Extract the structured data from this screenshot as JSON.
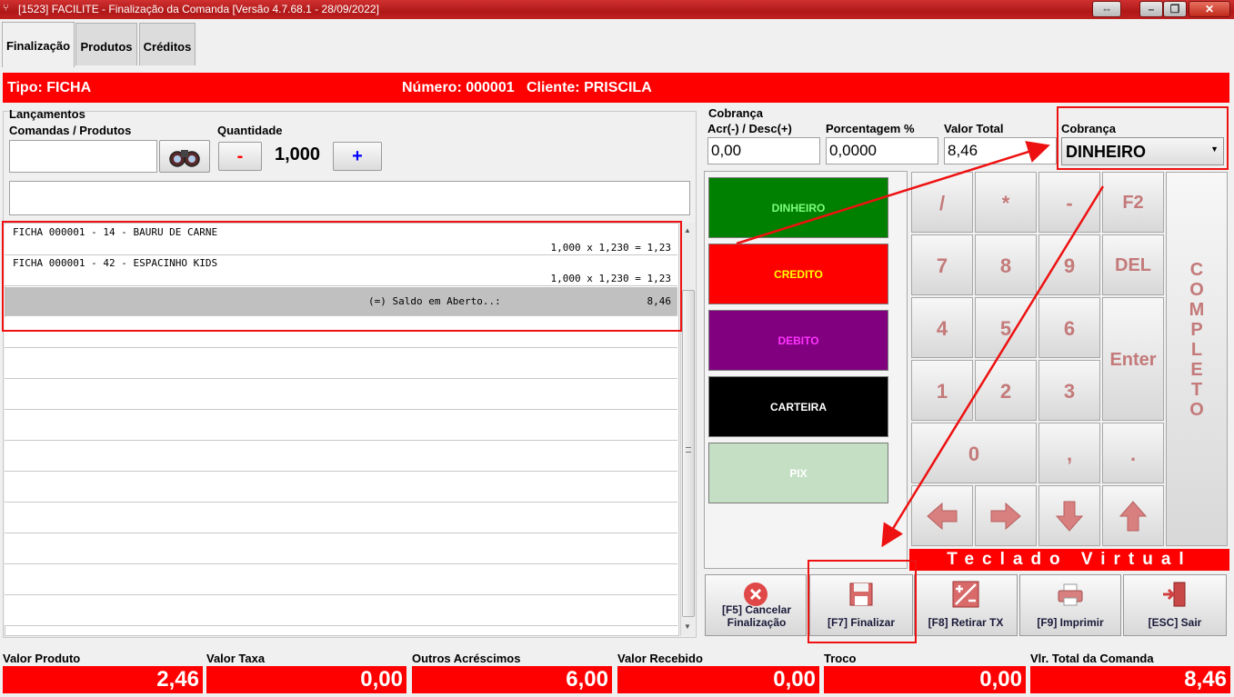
{
  "window": {
    "title": "[1523] FACILITE - Finalização da Comanda [Versão 4.7.68.1 - 28/09/2022]"
  },
  "tabs": [
    {
      "label": "Finalização"
    },
    {
      "label": "Produtos"
    },
    {
      "label": "Créditos"
    }
  ],
  "header": {
    "tipo": "Tipo: FICHA",
    "numero_cliente": "Número: 000001   Cliente: PRISCILA"
  },
  "lancamentos": {
    "title": "Lançamentos",
    "comandas_label": "Comandas / Produtos",
    "comandas_value": "",
    "quantidade_label": "Quantidade",
    "minus": "-",
    "plus": "+",
    "quantidade_value": "1,000"
  },
  "items": [
    {
      "desc": "FICHA 000001 - 14 - BAURU DE CARNE",
      "calc": "1,000 x 1,230 = 1,23"
    },
    {
      "desc": "FICHA 000001 - 42 - ESPACINHO KIDS",
      "calc": "1,000 x 1,230 = 1,23"
    }
  ],
  "saldo": {
    "label": "(=) Saldo em Aberto..:",
    "value": "8,46"
  },
  "cobranca": {
    "title": "Cobrança",
    "acr_label": "Acr(-) / Desc(+)",
    "acr_value": "0,00",
    "pct_label": "Porcentagem %",
    "pct_value": "0,0000",
    "total_label": "Valor Total",
    "total_value": "8,46",
    "tipo_label": "Cobrança",
    "tipo_value": "DINHEIRO"
  },
  "payments": [
    {
      "label": "DINHEIRO",
      "bg": "#008000",
      "fg": "#7cff7c"
    },
    {
      "label": "CREDITO",
      "bg": "#ff0000",
      "fg": "#ffff00"
    },
    {
      "label": "DEBITO",
      "bg": "#800080",
      "fg": "#ff33ff"
    },
    {
      "label": "CARTEIRA",
      "bg": "#000000",
      "fg": "#ffffff"
    },
    {
      "label": "PIX",
      "bg": "#c4dfc4",
      "fg": "#ffffff"
    }
  ],
  "keypad": {
    "keys": [
      "/",
      "*",
      "-",
      "F2",
      "7",
      "8",
      "9",
      "DEL",
      "4",
      "5",
      "6",
      "Enter",
      "1",
      "2",
      "3",
      "0",
      ",",
      "."
    ],
    "completo": "COMPLETO",
    "teclado": "Teclado Virtual"
  },
  "actions": {
    "cancel": "[F5] Cancelar Finalização",
    "finalizar": "[F7] Finalizar",
    "retirar": "[F8] Retirar TX",
    "imprimir": "[F9] Imprimir",
    "sair": "[ESC] Sair"
  },
  "totals": [
    {
      "label": "Valor Produto",
      "value": "2,46"
    },
    {
      "label": "Valor Taxa",
      "value": "0,00"
    },
    {
      "label": "Outros Acréscimos",
      "value": "6,00"
    },
    {
      "label": "Valor Recebido",
      "value": "0,00"
    },
    {
      "label": "Troco",
      "value": "0,00"
    },
    {
      "label": "Vlr. Total da Comanda",
      "value": "8,46"
    }
  ],
  "colors": {
    "accent_red": "#ff0000",
    "key_text": "#c47a7a"
  }
}
